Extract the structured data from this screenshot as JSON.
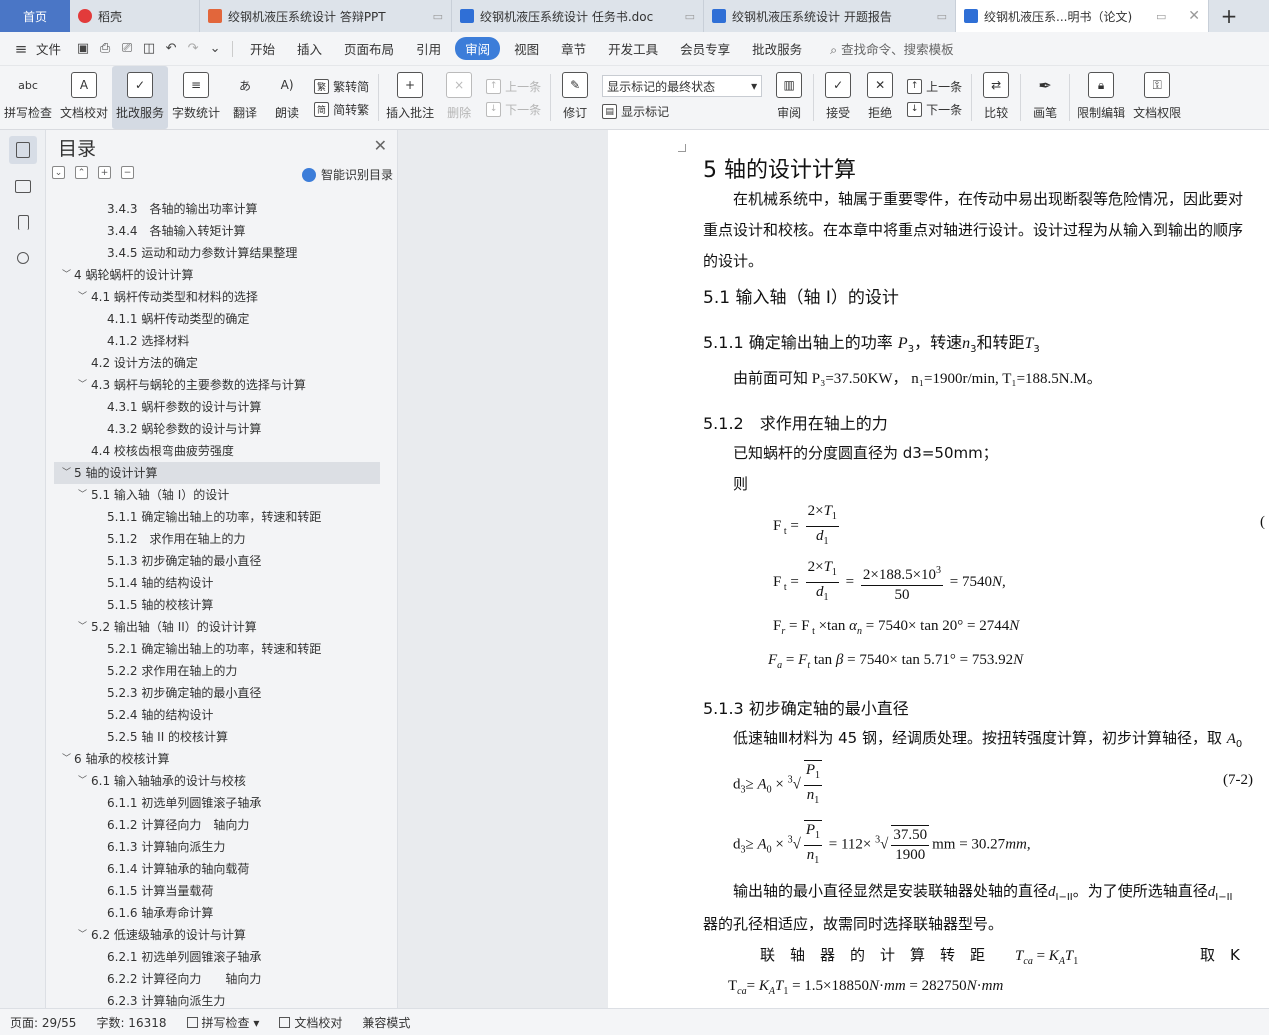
{
  "tabs": {
    "home": "首页",
    "items": [
      {
        "label": "稻壳",
        "icon": "wps-logo-icon"
      },
      {
        "label": "绞钢机液压系统设计 答辩PPT",
        "icon": "ppt-file-icon"
      },
      {
        "label": "绞钢机液压系统设计 任务书.doc",
        "icon": "doc-file-icon"
      },
      {
        "label": "绞钢机液压系统设计 开题报告",
        "icon": "doc-file-icon"
      },
      {
        "label": "绞钢机液压系...明书（论文)",
        "icon": "doc-file-icon"
      }
    ],
    "add": "+"
  },
  "menu": {
    "file": "文件",
    "items": [
      "开始",
      "插入",
      "页面布局",
      "引用",
      "审阅",
      "视图",
      "章节",
      "开发工具",
      "会员专享",
      "批改服务"
    ],
    "active": "审阅",
    "search": "查找命令、搜索模板"
  },
  "ribbon": {
    "spellcheck": "拼写检查",
    "doccheck": "文档校对",
    "correction": "批改服务",
    "wordcount": "字数统计",
    "translate": "翻译",
    "read": "朗读",
    "trad": "繁转简",
    "simp": "简转繁",
    "insert_comment": "插入批注",
    "delete": "删除",
    "prev": "上一条",
    "next": "下一条",
    "revise": "修订",
    "display_state": "显示标记的最终状态",
    "show_markup": "显示标记",
    "review": "审阅",
    "accept": "接受",
    "reject": "拒绝",
    "prev2": "上一条",
    "next2": "下一条",
    "compare": "比较",
    "pen": "画笔",
    "restrict": "限制编辑",
    "permission": "文档权限"
  },
  "toc": {
    "title": "目录",
    "smart": "智能识别目录",
    "items": [
      {
        "label": "3.4.3　各轴的输出功率计算",
        "level": 3
      },
      {
        "label": "3.4.4　各轴输入转矩计算",
        "level": 3
      },
      {
        "label": "3.4.5 运动和动力参数计算结果整理",
        "level": 3
      },
      {
        "label": "4 蜗轮蜗杆的设计计算",
        "level": 1,
        "arrow": "v"
      },
      {
        "label": "4.1 蜗杆传动类型和材料的选择",
        "level": 2,
        "arrow": "v"
      },
      {
        "label": "4.1.1 蜗杆传动类型的确定",
        "level": 3
      },
      {
        "label": "4.1.2 选择材料",
        "level": 3
      },
      {
        "label": "4.2  设计方法的确定",
        "level": 2
      },
      {
        "label": "4.3  蜗杆与蜗轮的主要参数的选择与计算",
        "level": 2,
        "arrow": "v"
      },
      {
        "label": "4.3.1  蜗杆参数的设计与计算",
        "level": 3
      },
      {
        "label": "4.3.2  蜗轮参数的设计与计算",
        "level": 3
      },
      {
        "label": "4.4  校核齿根弯曲疲劳强度",
        "level": 2
      },
      {
        "label": "5  轴的设计计算",
        "level": 1,
        "arrow": "v",
        "selected": true
      },
      {
        "label": "5.1  输入轴（轴 I）的设计",
        "level": 2,
        "arrow": "v"
      },
      {
        "label": "5.1.1  确定输出轴上的功率，转速和转距",
        "level": 3
      },
      {
        "label": "5.1.2　求作用在轴上的力",
        "level": 3
      },
      {
        "label": "5.1.3  初步确定轴的最小直径",
        "level": 3
      },
      {
        "label": "5.1.4  轴的结构设计",
        "level": 3
      },
      {
        "label": "5.1.5  轴的校核计算",
        "level": 3
      },
      {
        "label": "5.2  输出轴（轴 II）的设计计算",
        "level": 2,
        "arrow": "v"
      },
      {
        "label": "5.2.1  确定输出轴上的功率，转速和转距",
        "level": 3
      },
      {
        "label": "5.2.2  求作用在轴上的力",
        "level": 3
      },
      {
        "label": "5.2.3  初步确定轴的最小直径",
        "level": 3
      },
      {
        "label": "5.2.4  轴的结构设计",
        "level": 3
      },
      {
        "label": "5.2.5  轴 II 的校核计算",
        "level": 3
      },
      {
        "label": "6  轴承的校核计算",
        "level": 1,
        "arrow": "v"
      },
      {
        "label": "6.1  输入轴轴承的设计与校核",
        "level": 2,
        "arrow": "v"
      },
      {
        "label": "6.1.1  初选单列圆锥滚子轴承",
        "level": 3
      },
      {
        "label": "6.1.2  计算径向力　轴向力",
        "level": 3
      },
      {
        "label": "6.1.3  计算轴向派生力",
        "level": 3
      },
      {
        "label": "6.1.4  计算轴承的轴向载荷",
        "level": 3
      },
      {
        "label": "6.1.5  计算当量载荷",
        "level": 3
      },
      {
        "label": "6.1.6  轴承寿命计算",
        "level": 3
      },
      {
        "label": "6.2  低速级轴承的设计与计算",
        "level": 2,
        "arrow": "v"
      },
      {
        "label": "6.2.1  初选单列圆锥滚子轴承",
        "level": 3
      },
      {
        "label": "6.2.2  计算径向力　　轴向力",
        "level": 3
      },
      {
        "label": "6.2.3  计算轴向派生力",
        "level": 3
      }
    ]
  },
  "doc": {
    "h1": "5  轴的设计计算",
    "p1a": "在机械系统中，轴属于重要零件，在传动中易出现断裂等危险情况，因此要对",
    "p1b": "重点设计和校核。在本章中将重点对轴进行设计。设计过程为从输入到输出的顺序",
    "p1c": "的设计。",
    "h2": "5.1  输入轴（轴 I）的设计",
    "h511": "5.1.1  确定输出轴上的功率",
    "h511b": "，转速",
    "h511c": "和转距",
    "given": "由前面可知 P₃=37.50KW，  n₁=1900r/min, T₁=188.5N.M。",
    "h512": "5.1.2　求作用在轴上的力",
    "known": "已知蜗杆的分度圆直径为  d3=50mm；",
    "then": "则",
    "eqnum1": "(",
    "h513": "5.1.3  初步确定轴的最小直径",
    "p513": "低速轴Ⅲ材料为 45 钢，经调质处理。按扭转强度计算，初步计算轴径，取",
    "eqnum2": "(7-2)",
    "p513b": "输出轴的最小直径显然是安装联轴器处轴的直径",
    "p513c": "。为了使所选轴直径",
    "p513d": "器的孔径相适应，故需同时选择联轴器型号。",
    "torque": "联　轴　器　的　计　算　转　距",
    "take": "取　K"
  },
  "status": {
    "page": "页面: 29/55",
    "words": "字数: 16318",
    "spell": "拼写检查",
    "proof": "文档校对",
    "compat": "兼容模式"
  }
}
